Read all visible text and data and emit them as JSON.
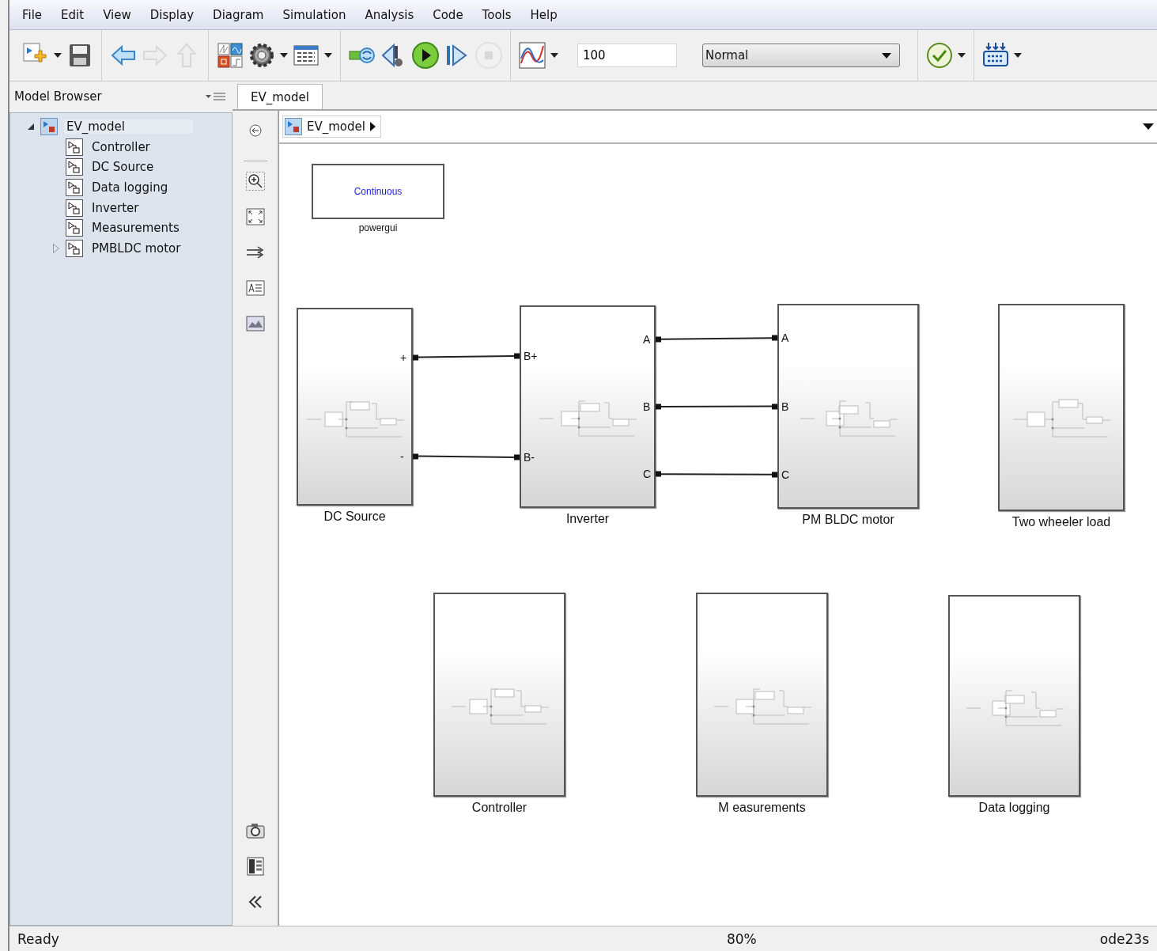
{
  "menu_bar": [
    "File",
    "Edit",
    "View",
    "Display",
    "Diagram",
    "Simulation",
    "Analysis",
    "Code",
    "Tools",
    "Help"
  ],
  "toolbar": {
    "groups": [
      {
        "items": [
          {
            "kind": "new-model",
            "disabled": false
          },
          {
            "kind": "caret",
            "disabled": false
          },
          {
            "kind": "save",
            "disabled": false
          }
        ]
      },
      {
        "items": [
          {
            "kind": "back",
            "disabled": false
          },
          {
            "kind": "forward",
            "disabled": true
          },
          {
            "kind": "up",
            "disabled": true
          }
        ]
      },
      {
        "items": [
          {
            "kind": "library",
            "disabled": false
          },
          {
            "kind": "settings",
            "disabled": false
          },
          {
            "kind": "caret",
            "disabled": false
          },
          {
            "kind": "explorer",
            "disabled": false
          },
          {
            "kind": "caret",
            "disabled": false
          }
        ]
      },
      {
        "items": [
          {
            "kind": "update",
            "disabled": false
          },
          {
            "kind": "step-back",
            "disabled": false
          },
          {
            "kind": "run",
            "disabled": false
          },
          {
            "kind": "step-forward",
            "disabled": false
          },
          {
            "kind": "stop",
            "disabled": true
          }
        ]
      },
      {
        "items": [
          {
            "kind": "scope",
            "disabled": false
          },
          {
            "kind": "caret",
            "disabled": false
          },
          {
            "kind": "stop-time",
            "value": "100",
            "disabled": false
          },
          {
            "kind": "sim-mode",
            "value": "Normal",
            "disabled": false
          }
        ]
      },
      {
        "items": [
          {
            "kind": "check",
            "disabled": false
          },
          {
            "kind": "caret",
            "disabled": false
          }
        ]
      },
      {
        "items": [
          {
            "kind": "build",
            "disabled": false
          },
          {
            "kind": "caret",
            "disabled": false
          }
        ]
      }
    ]
  },
  "model_browser": {
    "title": "Model Browser",
    "tree": [
      {
        "label": "EV_model",
        "kind": "model",
        "expanded": true,
        "selected": true,
        "children": [
          {
            "label": "Controller",
            "kind": "subsystem",
            "selected": false
          },
          {
            "label": "DC Source",
            "kind": "subsystem",
            "selected": false
          },
          {
            "label": "Data logging",
            "kind": "subsystem",
            "selected": false
          },
          {
            "label": "Inverter",
            "kind": "subsystem",
            "selected": false
          },
          {
            "label": "Measurements",
            "kind": "subsystem",
            "selected": false
          },
          {
            "label": "PMBLDC motor",
            "kind": "subsystem",
            "selected": false,
            "expanded": false
          }
        ]
      }
    ]
  },
  "tabs": [
    {
      "label": "EV_model",
      "selected": true
    }
  ],
  "breadcrumb": "EV_model",
  "diagram": {
    "blocks": [
      {
        "kind": "powergui",
        "name": "powergui",
        "text": "Continuous"
      },
      {
        "kind": "subsystem",
        "name": "DC Source",
        "right_ports": [
          {
            "label": "+",
            "wired": true
          },
          {
            "label": "-",
            "wired": true
          }
        ]
      },
      {
        "kind": "subsystem",
        "name": "Inverter",
        "left_ports": [
          {
            "label": "B+"
          },
          {
            "label": "B-"
          }
        ],
        "right_ports": [
          {
            "label": "A",
            "wired": true
          },
          {
            "label": "B",
            "wired": true
          },
          {
            "label": "C",
            "wired": true
          }
        ]
      },
      {
        "kind": "subsystem",
        "name": "PM BLDC motor",
        "left_ports": [
          {
            "label": "A"
          },
          {
            "label": "B"
          },
          {
            "label": "C"
          }
        ]
      },
      {
        "kind": "subsystem",
        "name": "Two wheeler load"
      },
      {
        "kind": "subsystem",
        "name": "Controller"
      },
      {
        "kind": "subsystem",
        "name": "M easurements"
      },
      {
        "kind": "subsystem",
        "name": "Data logging"
      }
    ]
  },
  "status_bar": {
    "state": "Ready",
    "zoom": "80%",
    "solver": "ode23s"
  }
}
